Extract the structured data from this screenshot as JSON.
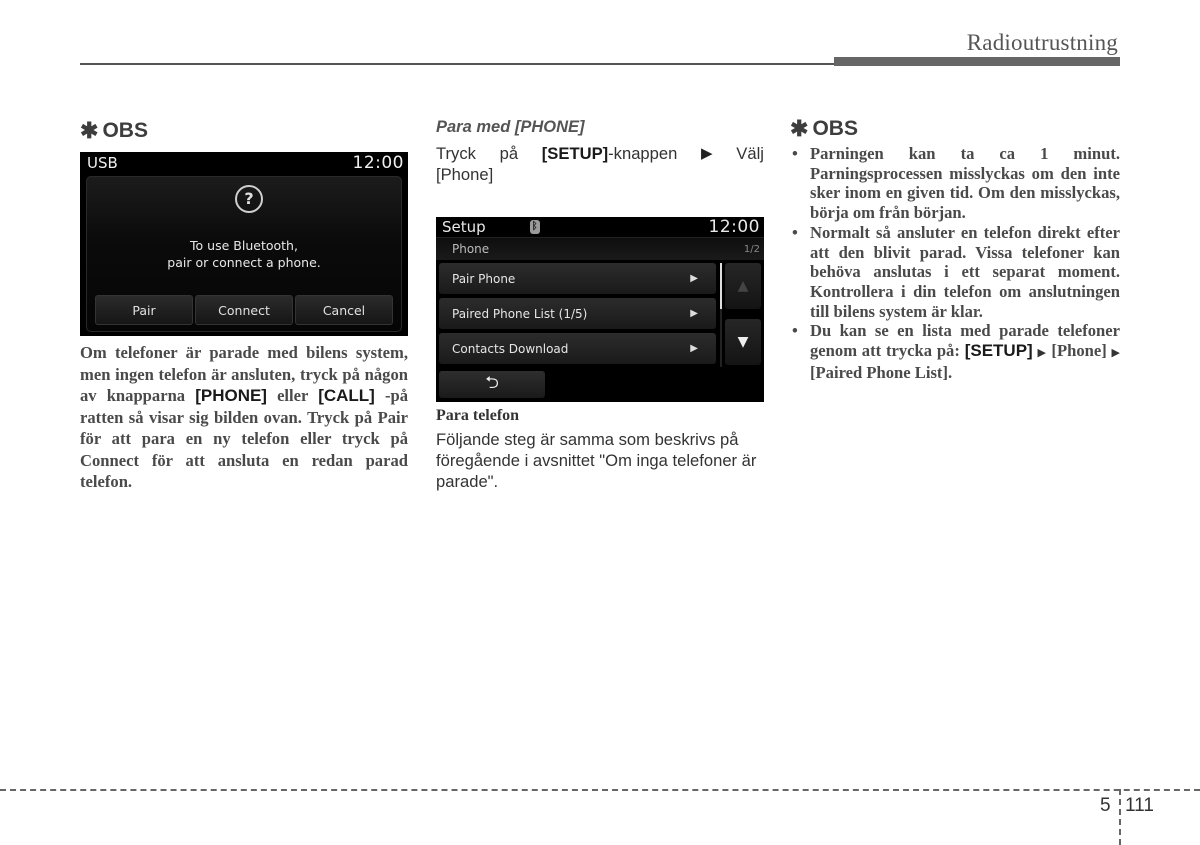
{
  "header": {
    "section_title": "Radioutrustning"
  },
  "column1": {
    "obs_heading": "OBS",
    "obs_star": "✱",
    "screen": {
      "source_label": "USB",
      "time": "12:00",
      "question_icon": "?",
      "message_line1": "To use Bluetooth,",
      "message_line2": "pair or connect a phone.",
      "buttons": [
        "Pair",
        "Connect",
        "Cancel"
      ]
    },
    "body_parts": {
      "t1": "Om telefoner är parade med bilens system, men ingen telefon är ansluten, tryck på någon av knapparna ",
      "k1": "[PHONE]",
      "t2": " eller ",
      "k2": "[CALL]",
      "t3": " -på ratten så visar sig bilden ovan. Tryck på Pair för att para en ny telefon eller tryck på Connect för att ansluta en redan parad telefon."
    }
  },
  "column2": {
    "subheading": "Para med [PHONE]",
    "instruction": {
      "w1": "Tryck",
      "w2": "på",
      "key": "[SETUP]",
      "w3": "-knappen",
      "arrow": "▶",
      "w4": "Välj",
      "line2": "[Phone]"
    },
    "screen": {
      "title": "Setup",
      "bluetooth_icon": "ᛒ",
      "time": "12:00",
      "subtitle": "Phone",
      "page": "1/2",
      "menu_items": [
        {
          "label": "Pair Phone",
          "arrow": "▶"
        },
        {
          "label": "Paired Phone List (1/5)",
          "arrow": "▶"
        },
        {
          "label": "Contacts Download",
          "arrow": "▶"
        }
      ],
      "up_arrow": "▲",
      "down_arrow": "▼",
      "back_icon": "⮌"
    },
    "caption": "Para telefon",
    "paragraph": "Följande steg är samma som beskrivs på föregående i avsnittet \"Om inga telefoner är parade\"."
  },
  "column3": {
    "obs_heading": "OBS",
    "obs_star": "✱",
    "bullets": {
      "b1": "Parningen kan ta ca 1 minut. Parningsprocessen misslyckas om den inte sker inom en given tid. Om den misslyckas, börja om från början.",
      "b2": "Normalt så ansluter en telefon direkt efter att den blivit parad. Vissa telefoner kan behöva anslutas i ett separat moment. Kontrollera i din telefon om anslutningen till bilens system är klar.",
      "b3_text": "Du kan se en lista med parade telefoner genom att trycka på: ",
      "b3_key": "[SETUP]",
      "b3_arrow": "▶",
      "b3_phone": " [Phone] ",
      "b3_list": " [Paired Phone List]."
    }
  },
  "footer": {
    "chapter": "5",
    "page": "111"
  }
}
